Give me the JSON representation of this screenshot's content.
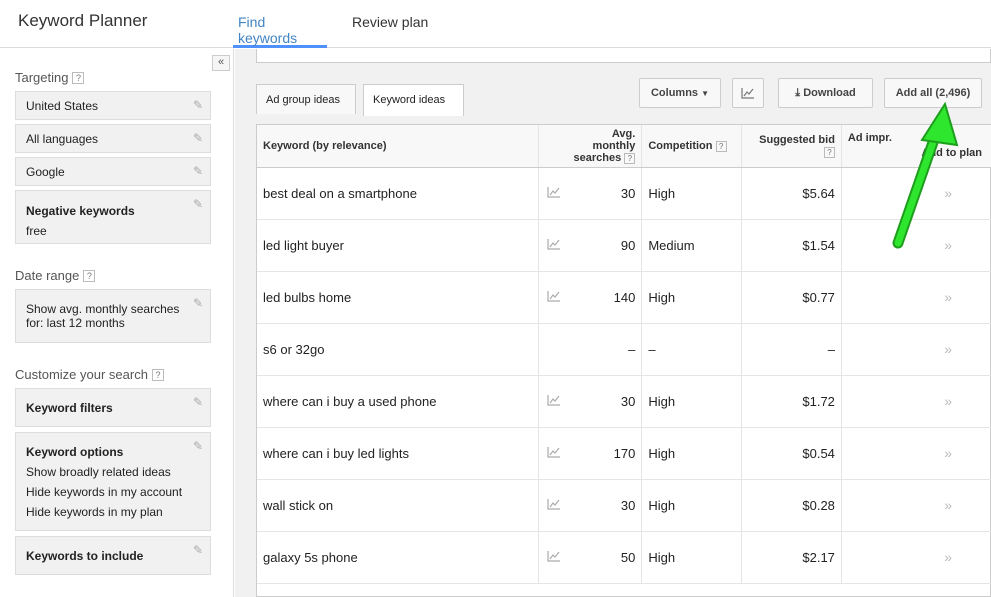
{
  "app": {
    "title": "Keyword Planner"
  },
  "top_tabs": [
    {
      "label": "Find keywords",
      "active": true
    },
    {
      "label": "Review plan",
      "active": false
    }
  ],
  "sidebar": {
    "collapse_icon": "double-chevron-left-icon",
    "targeting": {
      "title": "Targeting",
      "items": [
        "United States",
        "All languages",
        "Google"
      ],
      "negative": {
        "label": "Negative keywords",
        "value": "free"
      }
    },
    "date_range": {
      "title": "Date range",
      "text": "Show avg. monthly searches for: last 12 months"
    },
    "customize": {
      "title": "Customize your search",
      "filters_label": "Keyword filters",
      "options_label": "Keyword options",
      "options": [
        "Show broadly related ideas",
        "Hide keywords in my account",
        "Hide keywords in my plan"
      ],
      "include_label": "Keywords to include"
    }
  },
  "main": {
    "subtabs": [
      {
        "label": "Ad group ideas",
        "active": false
      },
      {
        "label": "Keyword ideas",
        "active": true
      }
    ],
    "toolbar": {
      "columns": "Columns",
      "download": "Download",
      "add_all": "Add all (2,496)"
    },
    "table": {
      "headers": {
        "keyword": "Keyword (by relevance)",
        "avg_line1": "Avg. monthly",
        "avg_line2": "searches",
        "competition": "Competition",
        "bid": "Suggested bid",
        "impr": "Ad impr.",
        "add": "Add to plan"
      },
      "rows": [
        {
          "keyword": "best deal on a smartphone",
          "avg": "30",
          "competition": "High",
          "bid": "$5.64",
          "chart": true
        },
        {
          "keyword": "led light buyer",
          "avg": "90",
          "competition": "Medium",
          "bid": "$1.54",
          "chart": true
        },
        {
          "keyword": "led bulbs home",
          "avg": "140",
          "competition": "High",
          "bid": "$0.77",
          "chart": true
        },
        {
          "keyword": "s6 or 32go",
          "avg": "–",
          "competition": "–",
          "bid": "–",
          "chart": false
        },
        {
          "keyword": "where can i buy a used phone",
          "avg": "30",
          "competition": "High",
          "bid": "$1.72",
          "chart": true
        },
        {
          "keyword": "where can i buy led lights",
          "avg": "170",
          "competition": "High",
          "bid": "$0.54",
          "chart": true
        },
        {
          "keyword": "wall stick on",
          "avg": "30",
          "competition": "High",
          "bid": "$0.28",
          "chart": true
        },
        {
          "keyword": "galaxy 5s phone",
          "avg": "50",
          "competition": "High",
          "bid": "$2.17",
          "chart": true
        }
      ]
    }
  },
  "annotation": {
    "color": "#2ee62e",
    "icon": "green-arrow"
  }
}
